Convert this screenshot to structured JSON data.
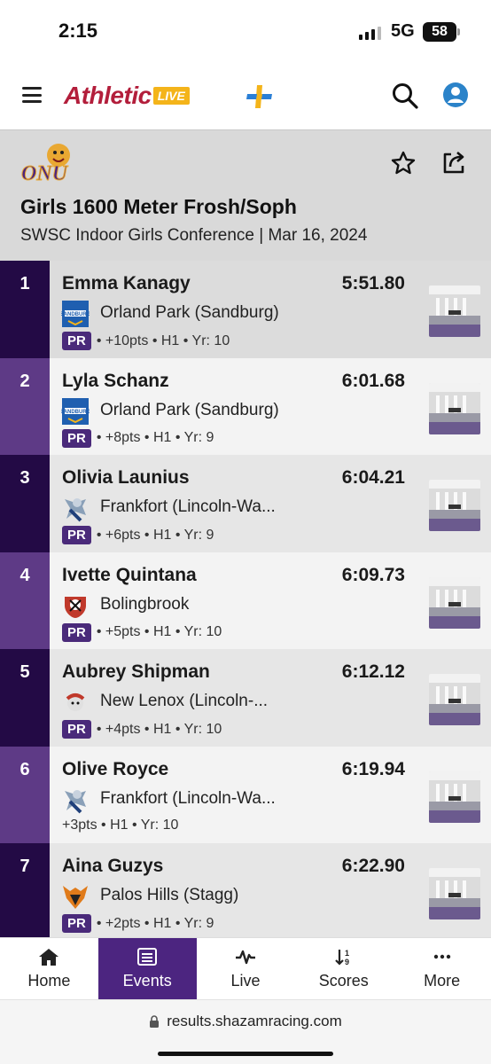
{
  "status_bar": {
    "time": "2:15",
    "network": "5G",
    "battery": "58"
  },
  "app": {
    "logo_text": "Athletic",
    "logo_badge": "LIVE"
  },
  "event": {
    "team_logo_text": "ONU",
    "title": "Girls 1600 Meter Frosh/Soph",
    "subtitle": "SWSC Indoor Girls Conference | Mar 16, 2024"
  },
  "results": [
    {
      "place": "1",
      "name": "Emma Kanagy",
      "mark": "5:51.80",
      "school": "Orland Park (Sandburg)",
      "pr": "PR",
      "meta": "• +10pts • H1 • Yr: 10",
      "logo": "sandburg"
    },
    {
      "place": "2",
      "name": "Lyla Schanz",
      "mark": "6:01.68",
      "school": "Orland Park (Sandburg)",
      "pr": "PR",
      "meta": "• +8pts • H1 • Yr: 9",
      "logo": "sandburg"
    },
    {
      "place": "3",
      "name": "Olivia Launius",
      "mark": "6:04.21",
      "school": "Frankfort (Lincoln-Wa...",
      "pr": "PR",
      "meta": "• +6pts • H1 • Yr: 9",
      "logo": "frankfort"
    },
    {
      "place": "4",
      "name": "Ivette Quintana",
      "mark": "6:09.73",
      "school": "Bolingbrook",
      "pr": "PR",
      "meta": "• +5pts • H1 • Yr: 10",
      "logo": "bolingbrook"
    },
    {
      "place": "5",
      "name": "Aubrey Shipman",
      "mark": "6:12.12",
      "school": "New Lenox (Lincoln-...",
      "pr": "PR",
      "meta": "• +4pts • H1 • Yr: 10",
      "logo": "newlenox"
    },
    {
      "place": "6",
      "name": "Olive Royce",
      "mark": "6:19.94",
      "school": "Frankfort (Lincoln-Wa...",
      "pr": "",
      "meta": "+3pts • H1 • Yr: 10",
      "logo": "frankfort"
    },
    {
      "place": "7",
      "name": "Aina Guzys",
      "mark": "6:22.90",
      "school": "Palos Hills (Stagg)",
      "pr": "PR",
      "meta": "• +2pts • H1 • Yr: 9",
      "logo": "stagg"
    }
  ],
  "nav": [
    {
      "label": "Home",
      "icon": "home-icon"
    },
    {
      "label": "Events",
      "icon": "list-icon"
    },
    {
      "label": "Live",
      "icon": "pulse-icon"
    },
    {
      "label": "Scores",
      "icon": "sort-icon"
    },
    {
      "label": "More",
      "icon": "more-icon"
    }
  ],
  "browser": {
    "url": "results.shazamracing.com"
  },
  "colors": {
    "brand_purple": "#4c2580",
    "dark_purple": "#2a0a4a",
    "logo_red": "#b31e3b",
    "logo_gold": "#f4b41a"
  }
}
